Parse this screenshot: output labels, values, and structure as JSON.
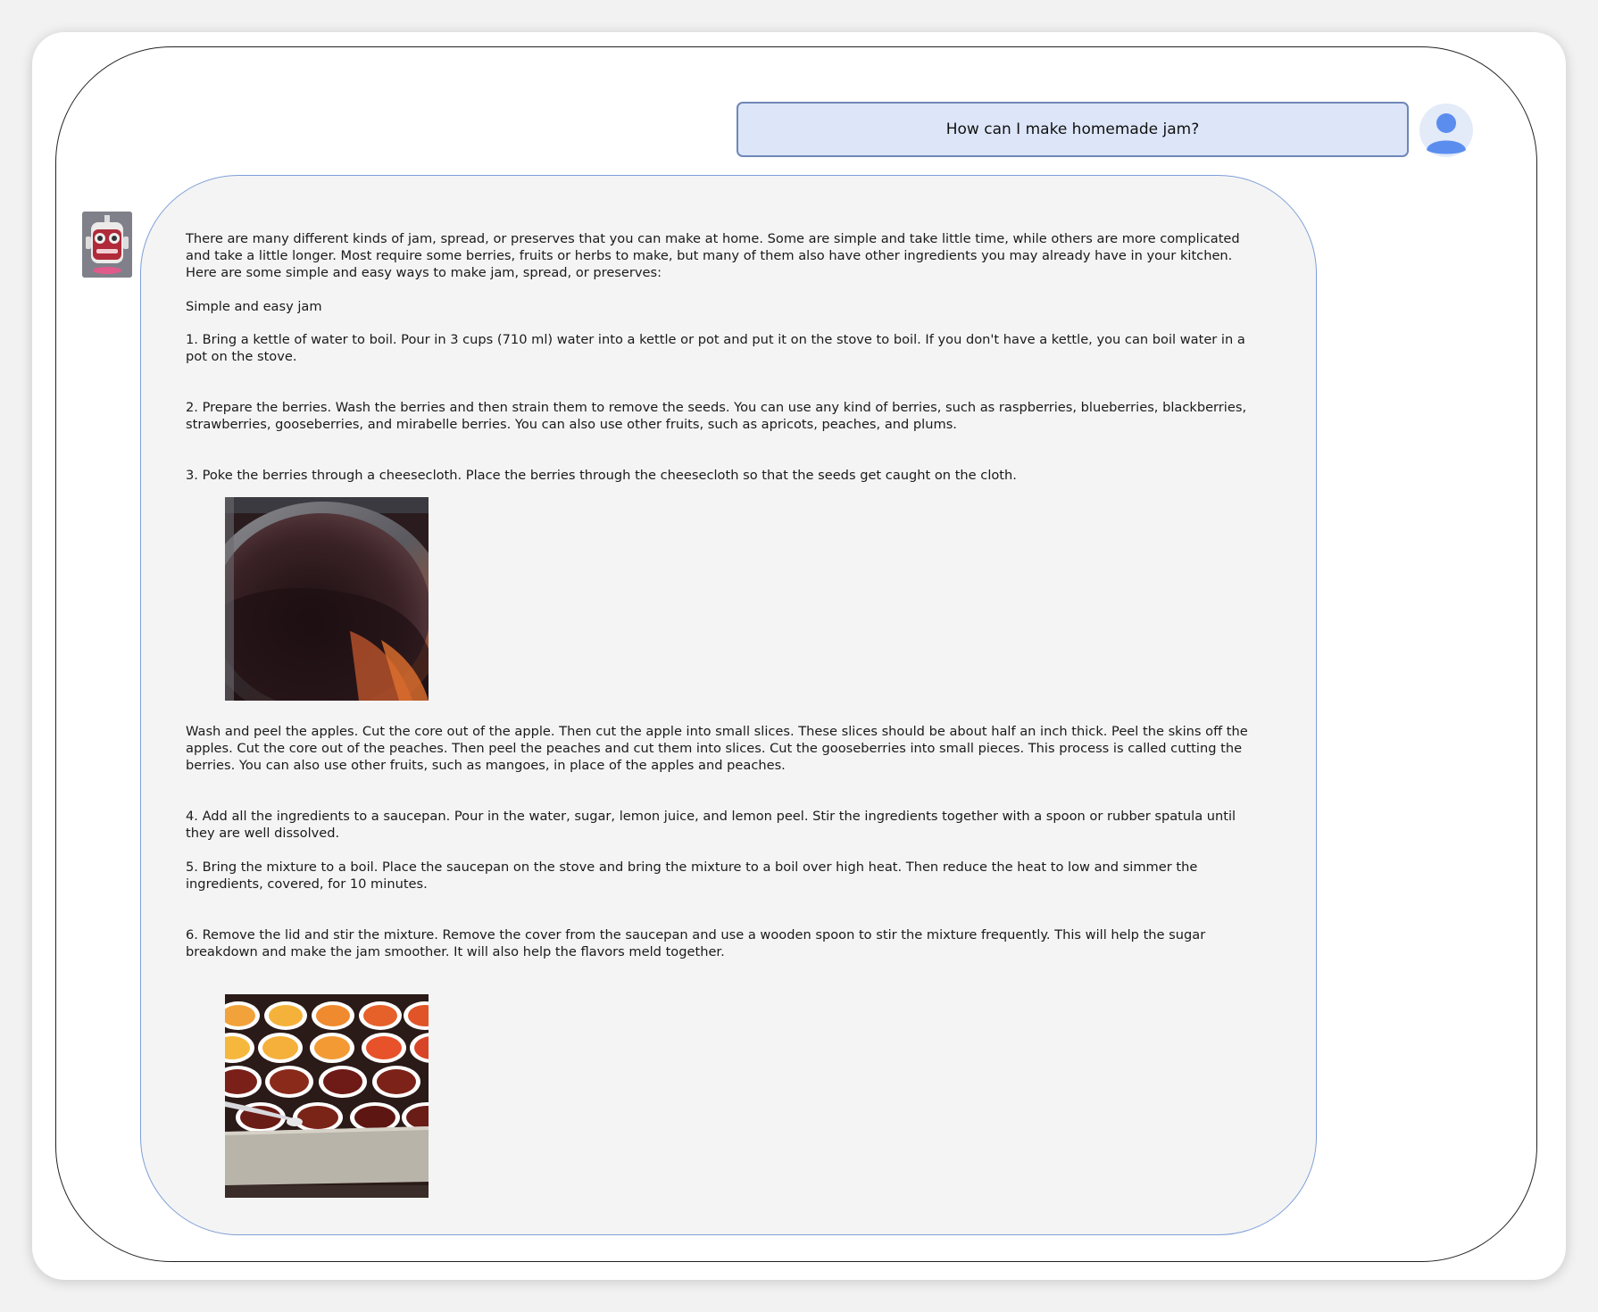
{
  "user": {
    "message": "How can I make homemade jam?",
    "avatar_icon": "user-avatar-icon"
  },
  "assistant": {
    "avatar_icon": "robot-avatar-icon",
    "intro": "There are many different kinds of jam, spread, or preserves that you can make at home. Some are simple and take little time, while others are more complicated and take a little longer. Most require some berries, fruits or herbs to make, but many of them also have other ingredients you may already have in your kitchen.",
    "intro2": "Here are some simple and easy ways to make jam, spread, or preserves:",
    "heading": "Simple and easy jam",
    "step1": "1. Bring a kettle of water to boil. Pour in 3 cups (710 ml) water into a kettle or pot and put it on the stove to boil. If you don't have a kettle, you can boil water in a pot on the stove.",
    "step2": "2. Prepare the berries. Wash the berries and then strain them to remove the seeds. You can use any kind of berries, such as raspberries, blueberries, blackberries,  strawberries, gooseberries, and mirabelle berries. You can also use other fruits, such as apricots, peaches, and plums.",
    "step3": "3. Poke the berries through a cheesecloth. Place the berries through the cheesecloth so that the seeds get caught on the cloth.",
    "image1_icon": "pot-photo",
    "wash_paragraph": "Wash and peel the apples. Cut the core out of the apple. Then cut the apple into small slices. These slices should be about half an inch thick. Peel the skins off the apples. Cut the core  out of the peaches. Then peel the peaches and cut them into slices. Cut the gooseberries into small pieces. This process is called cutting the berries. You can also use other fruits, such as mangoes, in place of the apples and peaches.",
    "step4": "4. Add all the ingredients to a saucepan. Pour in the water, sugar, lemon juice, and lemon peel.  Stir the ingredients together with a spoon or rubber spatula until they are well dissolved.",
    "step5": "5. Bring the mixture to a boil. Place the saucepan on the stove and bring the mixture to a boil over high heat. Then reduce the heat to low and simmer the ingredients, covered, for 10 minutes.",
    "step6": "6. Remove the lid and stir the mixture. Remove the cover from the saucepan and use a wooden spoon to stir the mixture frequently. This will help the sugar breakdown and make the jam smoother. It will also help the flavors meld together.",
    "image2_icon": "jam-cups-photo"
  },
  "colors": {
    "user_bubble_bg": "#dde6f8",
    "user_bubble_border": "#6f87b8",
    "assistant_bubble_border": "#7e9fd8",
    "assistant_bubble_bg": "#f4f4f4"
  }
}
